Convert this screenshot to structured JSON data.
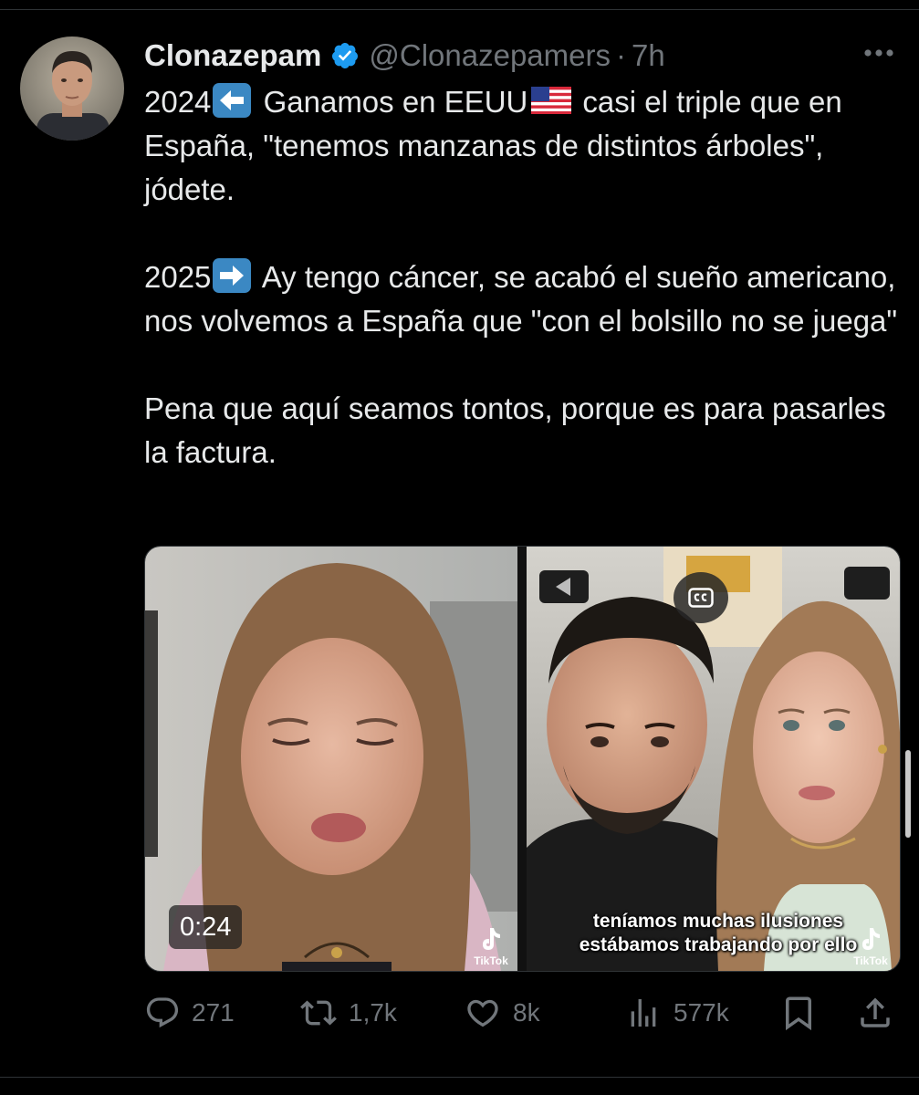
{
  "tweet": {
    "display_name": "Clonazepam",
    "handle": "@Clonazepamers",
    "separator": "·",
    "time": "7h",
    "verified": true,
    "text": {
      "p1_year": "2024",
      "p1_rest_a": " Ganamos en EEUU",
      "p1_rest_b": "casi el triple que en España, \"tenemos manzanas de distintos árboles\", jódete.",
      "p2_year": "2025",
      "p2_rest_a": " Ay tengo cáncer, se acabó el sueño americano, nos volvemos a España que \"con el bolsillo no se juega\"",
      "p3": "Pena que aquí seamos tontos, porque es para pasarles la factura."
    },
    "icons": {
      "left_arrow_emoji": "left-arrow-emoji",
      "right_arrow_emoji": "right-arrow-emoji",
      "flag": "us-flag-emoji"
    }
  },
  "media": {
    "duration": "0:24",
    "caption": "teníamos muchas ilusiones estábamos trabajando por ello",
    "tiktok_label_left": "TikTok",
    "tiktok_label_right": "TikTok",
    "cc_label": "CC"
  },
  "actions": {
    "replies": "271",
    "reposts": "1,7k",
    "likes": "8k",
    "views": "577k"
  },
  "colors": {
    "background": "#000000",
    "text": "#e7e9ea",
    "muted": "#71767b",
    "verified": "#1d9bf0",
    "emoji_box": "#3b88c3"
  }
}
